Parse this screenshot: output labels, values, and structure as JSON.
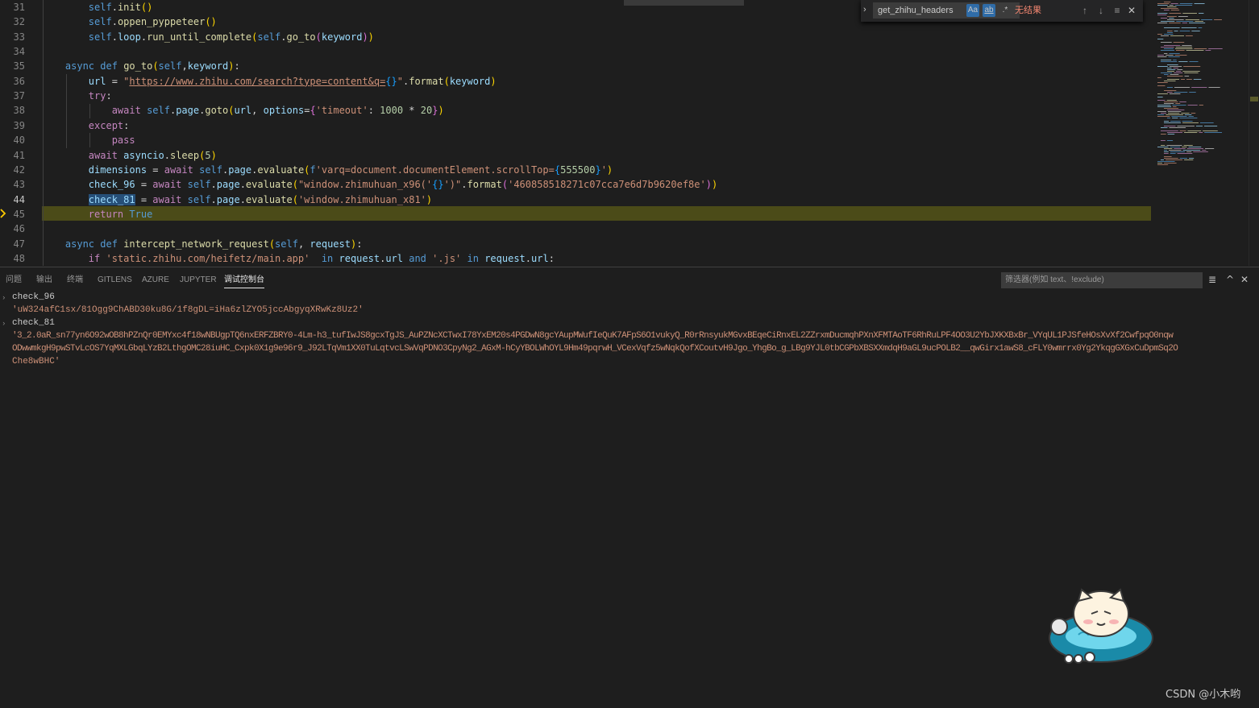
{
  "editor": {
    "lines": [
      {
        "num": "31",
        "tokens": [
          [
            "txt",
            "        "
          ],
          [
            "kw",
            "self"
          ],
          [
            "txt",
            "."
          ],
          [
            "fn",
            "init"
          ],
          [
            "brc",
            "()"
          ]
        ]
      },
      {
        "num": "32",
        "tokens": [
          [
            "txt",
            "        "
          ],
          [
            "kw",
            "self"
          ],
          [
            "txt",
            "."
          ],
          [
            "fn",
            "oppen_pyppeteer"
          ],
          [
            "brc",
            "()"
          ]
        ]
      },
      {
        "num": "33",
        "tokens": [
          [
            "txt",
            "        "
          ],
          [
            "kw",
            "self"
          ],
          [
            "txt",
            "."
          ],
          [
            "vr",
            "loop"
          ],
          [
            "txt",
            "."
          ],
          [
            "fn",
            "run_until_complete"
          ],
          [
            "brc",
            "("
          ],
          [
            "kw",
            "self"
          ],
          [
            "txt",
            "."
          ],
          [
            "fn",
            "go_to"
          ],
          [
            "brc2",
            "("
          ],
          [
            "vr",
            "keyword"
          ],
          [
            "brc2",
            ")"
          ],
          [
            "brc",
            ")"
          ]
        ]
      },
      {
        "num": "34",
        "tokens": []
      },
      {
        "num": "35",
        "tokens": [
          [
            "txt",
            "    "
          ],
          [
            "kw",
            "async"
          ],
          [
            "txt",
            " "
          ],
          [
            "kw",
            "def"
          ],
          [
            "txt",
            " "
          ],
          [
            "fn",
            "go_to"
          ],
          [
            "brc",
            "("
          ],
          [
            "kw",
            "self"
          ],
          [
            "txt",
            ","
          ],
          [
            "vr",
            "keyword"
          ],
          [
            "brc",
            ")"
          ],
          [
            "txt",
            ":"
          ]
        ]
      },
      {
        "num": "36",
        "tokens": [
          [
            "txt",
            "        "
          ],
          [
            "vr",
            "url"
          ],
          [
            "txt",
            " = "
          ],
          [
            "str",
            "\""
          ],
          [
            "url",
            "https://www.zhihu.com/search?type=content&q="
          ],
          [
            "brc3",
            "{}"
          ],
          [
            "str",
            "\""
          ],
          [
            "txt",
            "."
          ],
          [
            "fn",
            "format"
          ],
          [
            "brc",
            "("
          ],
          [
            "vr",
            "keyword"
          ],
          [
            "brc",
            ")"
          ]
        ]
      },
      {
        "num": "37",
        "tokens": [
          [
            "txt",
            "        "
          ],
          [
            "ctl",
            "try"
          ],
          [
            "txt",
            ":"
          ]
        ]
      },
      {
        "num": "38",
        "tokens": [
          [
            "txt",
            "            "
          ],
          [
            "ctl",
            "await"
          ],
          [
            "txt",
            " "
          ],
          [
            "kw",
            "self"
          ],
          [
            "txt",
            "."
          ],
          [
            "vr",
            "page"
          ],
          [
            "txt",
            "."
          ],
          [
            "fn",
            "goto"
          ],
          [
            "brc",
            "("
          ],
          [
            "vr",
            "url"
          ],
          [
            "txt",
            ", "
          ],
          [
            "vr",
            "options"
          ],
          [
            "txt",
            "="
          ],
          [
            "brc2",
            "{"
          ],
          [
            "str",
            "'timeout'"
          ],
          [
            "txt",
            ": "
          ],
          [
            "num",
            "1000"
          ],
          [
            "txt",
            " * "
          ],
          [
            "num",
            "20"
          ],
          [
            "brc2",
            "}"
          ],
          [
            "brc",
            ")"
          ]
        ]
      },
      {
        "num": "39",
        "tokens": [
          [
            "txt",
            "        "
          ],
          [
            "ctl",
            "except"
          ],
          [
            "txt",
            ":"
          ]
        ]
      },
      {
        "num": "40",
        "tokens": [
          [
            "txt",
            "            "
          ],
          [
            "ctl",
            "pass"
          ]
        ]
      },
      {
        "num": "41",
        "tokens": [
          [
            "txt",
            "        "
          ],
          [
            "ctl",
            "await"
          ],
          [
            "txt",
            " "
          ],
          [
            "vr",
            "asyncio"
          ],
          [
            "txt",
            "."
          ],
          [
            "fn",
            "sleep"
          ],
          [
            "brc",
            "("
          ],
          [
            "num",
            "5"
          ],
          [
            "brc",
            ")"
          ]
        ]
      },
      {
        "num": "42",
        "tokens": [
          [
            "txt",
            "        "
          ],
          [
            "vr",
            "dimensions"
          ],
          [
            "txt",
            " = "
          ],
          [
            "ctl",
            "await"
          ],
          [
            "txt",
            " "
          ],
          [
            "kw",
            "self"
          ],
          [
            "txt",
            "."
          ],
          [
            "vr",
            "page"
          ],
          [
            "txt",
            "."
          ],
          [
            "fn",
            "evaluate"
          ],
          [
            "brc",
            "("
          ],
          [
            "kw",
            "f"
          ],
          [
            "str",
            "'varq=document.documentElement.scrollTop="
          ],
          [
            "brc3",
            "{"
          ],
          [
            "num",
            "555500"
          ],
          [
            "brc3",
            "}"
          ],
          [
            "str",
            "'"
          ],
          [
            "brc",
            ")"
          ]
        ]
      },
      {
        "num": "43",
        "tokens": [
          [
            "txt",
            "        "
          ],
          [
            "vr",
            "check_96"
          ],
          [
            "txt",
            " = "
          ],
          [
            "ctl",
            "await"
          ],
          [
            "txt",
            " "
          ],
          [
            "kw",
            "self"
          ],
          [
            "txt",
            "."
          ],
          [
            "vr",
            "page"
          ],
          [
            "txt",
            "."
          ],
          [
            "fn",
            "evaluate"
          ],
          [
            "brc",
            "("
          ],
          [
            "str",
            "\"window.zhimuhuan_x96('"
          ],
          [
            "brc3",
            "{}"
          ],
          [
            "str",
            "')\""
          ],
          [
            "txt",
            "."
          ],
          [
            "fn",
            "format"
          ],
          [
            "brc2",
            "("
          ],
          [
            "str",
            "'460858518271c07cca7e6d7b9620ef8e'"
          ],
          [
            "brc2",
            ")"
          ],
          [
            "brc",
            ")"
          ]
        ]
      },
      {
        "num": "44",
        "tokens": [
          [
            "txt",
            "        "
          ],
          [
            "vr sel",
            "check_81"
          ],
          [
            "txt",
            " = "
          ],
          [
            "ctl",
            "await"
          ],
          [
            "txt",
            " "
          ],
          [
            "kw",
            "self"
          ],
          [
            "txt",
            "."
          ],
          [
            "vr",
            "page"
          ],
          [
            "txt",
            "."
          ],
          [
            "fn",
            "evaluate"
          ],
          [
            "brc",
            "("
          ],
          [
            "str",
            "'window.zhimuhuan_x81'"
          ],
          [
            "brc",
            ")"
          ]
        ]
      },
      {
        "num": "45",
        "tokens": [
          [
            "txt",
            "        "
          ],
          [
            "ctl",
            "return"
          ],
          [
            "txt",
            " "
          ],
          [
            "kw",
            "True"
          ]
        ]
      },
      {
        "num": "46",
        "tokens": []
      },
      {
        "num": "47",
        "tokens": [
          [
            "txt",
            "    "
          ],
          [
            "kw",
            "async"
          ],
          [
            "txt",
            " "
          ],
          [
            "kw",
            "def"
          ],
          [
            "txt",
            " "
          ],
          [
            "fn",
            "intercept_network_request"
          ],
          [
            "brc",
            "("
          ],
          [
            "kw",
            "self"
          ],
          [
            "txt",
            ", "
          ],
          [
            "vr",
            "request"
          ],
          [
            "brc",
            ")"
          ],
          [
            "txt",
            ":"
          ]
        ]
      },
      {
        "num": "48",
        "tokens": [
          [
            "txt",
            "        "
          ],
          [
            "ctl",
            "if"
          ],
          [
            "txt",
            " "
          ],
          [
            "str",
            "'static.zhihu.com/heifetz/main.app'"
          ],
          [
            "txt",
            "  "
          ],
          [
            "kw",
            "in"
          ],
          [
            "txt",
            " "
          ],
          [
            "vr",
            "request"
          ],
          [
            "txt",
            "."
          ],
          [
            "vr",
            "url"
          ],
          [
            "txt",
            " "
          ],
          [
            "kw",
            "and"
          ],
          [
            "txt",
            " "
          ],
          [
            "str",
            "'.js'"
          ],
          [
            "txt",
            " "
          ],
          [
            "kw",
            "in"
          ],
          [
            "txt",
            " "
          ],
          [
            "vr",
            "request"
          ],
          [
            "txt",
            "."
          ],
          [
            "vr",
            "url"
          ],
          [
            "txt",
            ":"
          ]
        ]
      }
    ],
    "active_line": "44",
    "stopped_line": "45"
  },
  "find": {
    "toggle": "›",
    "query": "get_zhihu_headers",
    "match_case": "Aa",
    "whole_word": "ab",
    "regex": ".*",
    "result": "无结果",
    "prev": "↑",
    "next": "↓",
    "in_selection": "≡",
    "close": "✕"
  },
  "panel": {
    "tabs": [
      "问题",
      "输出",
      "终端",
      "GITLENS",
      "AZURE",
      "JUPYTER",
      "调试控制台"
    ],
    "active_tab": "调试控制台",
    "filter_placeholder": "筛选器(例如 text、!exclude)",
    "icons": {
      "clear": "≣",
      "maximize": "^",
      "close": "✕"
    }
  },
  "console": [
    {
      "kind": "var",
      "text": "check_96"
    },
    {
      "kind": "str",
      "text": "'uW324afC1sx/81Ogg9ChABD30ku8G/1f8gDL=iHa6zlZYO5jccAbgyqXRwKz8Uz2'"
    },
    {
      "kind": "var",
      "text": "check_81"
    },
    {
      "kind": "str",
      "text": "'3_2.0aR_sn77yn6O92wOB8hPZnQr0EMYxc4f18wNBUgpTQ6nxERFZBRY0-4Lm-h3_tufIwJS8gcxTgJS_AuPZNcXCTwxI78YxEM20s4PGDwN8gcYAupMWufIeQuK7AFpS6O1vukyQ_R0rRnsyukMGvxBEqeCiRnxEL2ZZrxmDucmqhPXnXFMTAoTF6RhRuLPF4OO3U2YbJXKXBxBr_VYqUL1PJSfeHOsXvXf2CwfpqO0nqw"
    },
    {
      "kind": "str",
      "text": "ODwwmkgH9pwSTvLcOS7YqMXLGbqLYzB2LthgOMC28iuHC_Cxpk0X1g9e96r9_J92LTqVm1XX0TuLqtvcLSwVqPDNO3CpyNg2_AGxM-hCyYBOLWhOYL9Hm49pqrwH_VCexVqfz5wNqkQofXCoutvH9Jgo_YhgBo_g_LBg9YJL0tbCGPbXBSXXmdqH9aGL9ucPOLB2__qwGirx1awS8_cFLY0wmrrx0Yg2YkqgGXGxCuDpmSq2O"
    },
    {
      "kind": "str",
      "text": "Che8wBHC'"
    }
  ],
  "watermark": "CSDN @小木哟",
  "colors": {
    "editor_bg": "#1e1e1e",
    "stop_line": "#4b4b18",
    "keyword": "#569cd6",
    "control": "#c586c0",
    "function": "#dcdcaa",
    "variable": "#9cdcfe",
    "string": "#ce9178",
    "number": "#b5cea8",
    "error": "#f48771"
  }
}
